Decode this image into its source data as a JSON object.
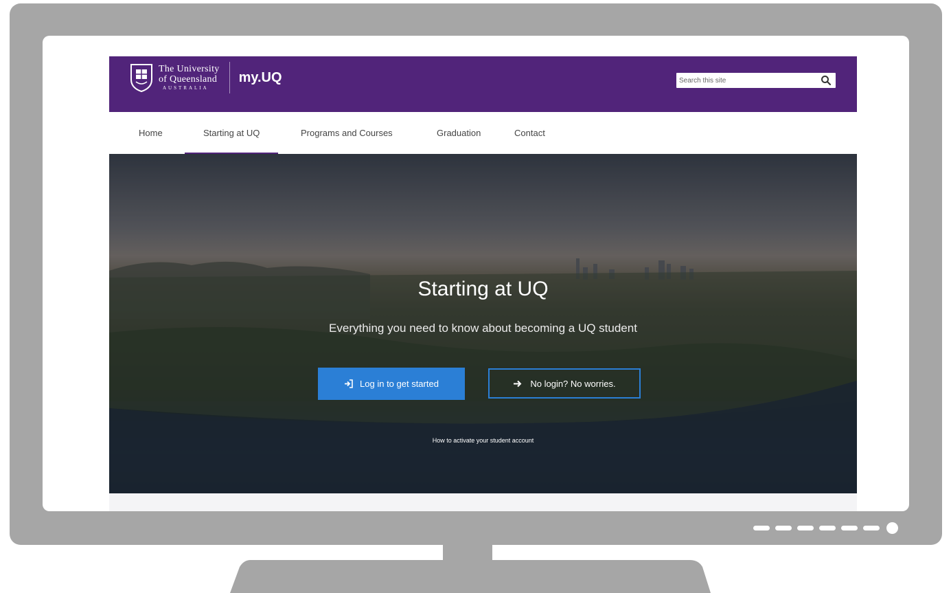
{
  "logo": {
    "line1": "The University",
    "line2": "of Queensland",
    "line3": "AUSTRALIA"
  },
  "site_name": "my.UQ",
  "search": {
    "placeholder": "Search this site"
  },
  "nav": {
    "items": [
      {
        "label": "Home"
      },
      {
        "label": "Starting at UQ",
        "active": true
      },
      {
        "label": "Programs and Courses"
      },
      {
        "label": "Graduation"
      },
      {
        "label": "Contact"
      }
    ]
  },
  "hero": {
    "title": "Starting at UQ",
    "subtitle": "Everything you need to know about becoming a UQ student",
    "login_label": "Log in to get started",
    "nologin_label": "No login? No worries.",
    "activate_link": "How to activate your student account"
  },
  "colors": {
    "brand_purple": "#51247a",
    "button_blue": "#2b7fd6",
    "bezel_gray": "#a6a6a6"
  },
  "icons": [
    "crest-logo-icon",
    "search-icon",
    "login-icon",
    "arrow-right-icon"
  ]
}
